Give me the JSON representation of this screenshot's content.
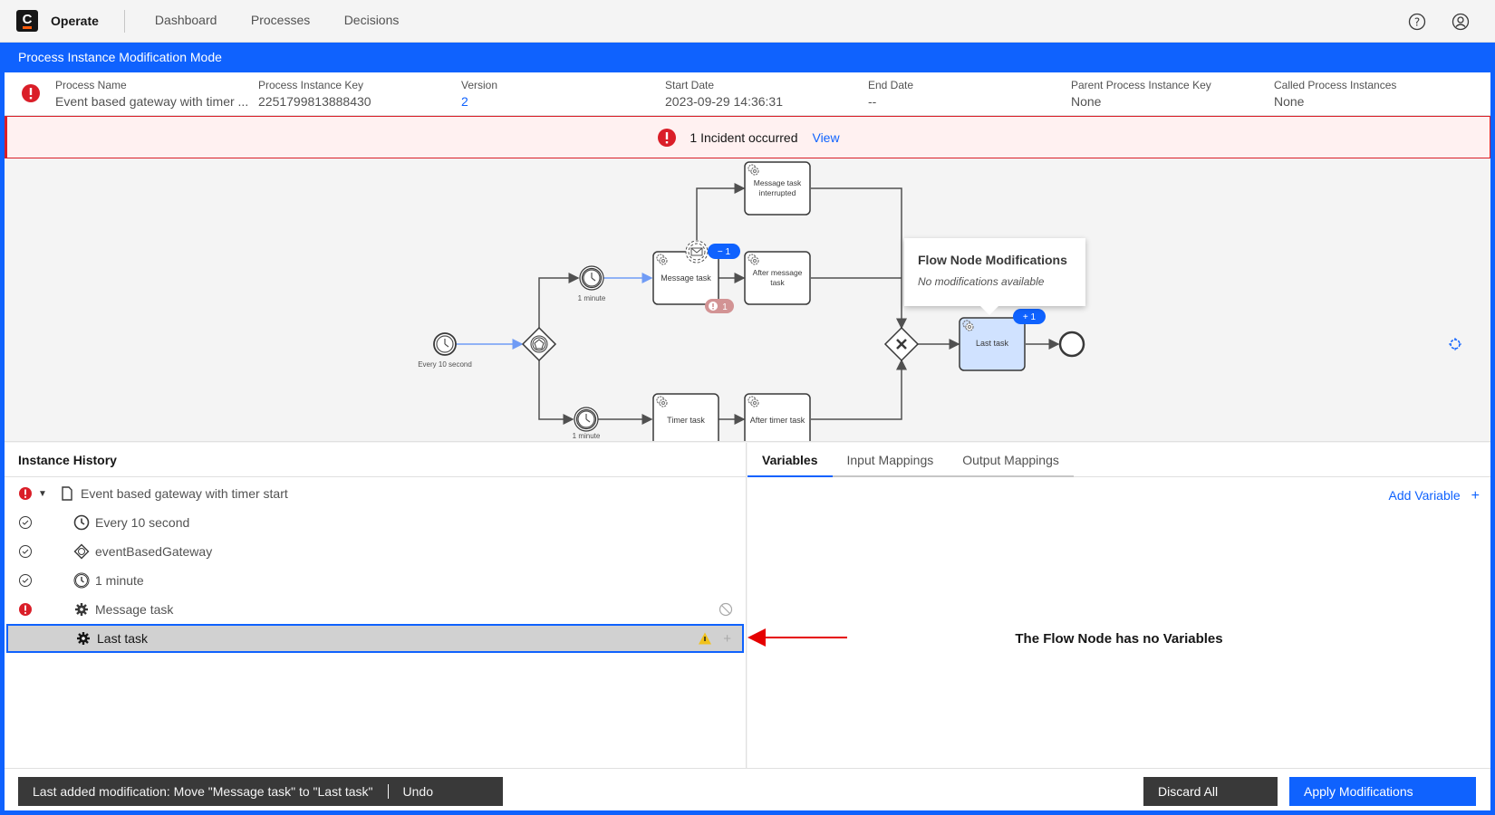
{
  "topbar": {
    "brand": "Operate",
    "logo_letter": "C",
    "nav": [
      "Dashboard",
      "Processes",
      "Decisions"
    ],
    "icons": [
      "help-icon",
      "user-profile-icon"
    ]
  },
  "mode_bar": {
    "title": "Process Instance Modification Mode"
  },
  "instance_header": {
    "state": "incident",
    "columns": [
      {
        "label": "Process Name",
        "value": "Event based gateway with timer ..."
      },
      {
        "label": "Process Instance Key",
        "value": "2251799813888430"
      },
      {
        "label": "Version",
        "value": "2"
      },
      {
        "label": "Start Date",
        "value": "2023-09-29 14:36:31"
      },
      {
        "label": "End Date",
        "value": "--"
      },
      {
        "label": "Parent Process Instance Key",
        "value": "None"
      },
      {
        "label": "Called Process Instances",
        "value": "None"
      }
    ]
  },
  "incident_banner": {
    "text": "1 Incident occurred",
    "link": "View"
  },
  "diagram": {
    "labels": {
      "start_event": "Every 10 second",
      "timer_top": "1 minute",
      "timer_bottom": "1 minute",
      "message_task": "Message task",
      "message_task_interrupted_1": "Message task",
      "message_task_interrupted_2": "interrupted",
      "after_message_task_1": "After message",
      "after_message_task_2": "task",
      "timer_task": "Timer task",
      "after_timer_task": "After timer task",
      "last_task": "Last task"
    },
    "badges": {
      "message_task_cancel": "− 1",
      "message_task_incident": "1",
      "last_task_add": "+ 1"
    },
    "tooltip": {
      "title": "Flow Node Modifications",
      "message": "No modifications available"
    },
    "zoom_controls": {
      "reset": "⌖",
      "zoom_in": "+",
      "zoom_out": "−"
    }
  },
  "instance_history": {
    "title": "Instance History",
    "rows": [
      {
        "name": "Event based gateway with timer start",
        "status": "incident",
        "icon": "document-icon",
        "expanded": true
      },
      {
        "name": "Every 10 second",
        "status": "completed",
        "icon": "timer-icon"
      },
      {
        "name": "eventBasedGateway",
        "status": "completed",
        "icon": "event-gateway-icon"
      },
      {
        "name": "1 minute",
        "status": "completed",
        "icon": "timer-intermediate-icon"
      },
      {
        "name": "Message task",
        "status": "incident",
        "icon": "service-task-icon",
        "action": "cancel-icon"
      },
      {
        "name": "Last task",
        "status": "added",
        "icon": "service-task-icon",
        "selected": true,
        "actions": [
          "warning-icon",
          "add-icon"
        ]
      }
    ]
  },
  "variables_panel": {
    "tabs": [
      "Variables",
      "Input Mappings",
      "Output Mappings"
    ],
    "active_tab": "Variables",
    "add_variable": "Add Variable",
    "add_symbol": "+",
    "empty_message": "The Flow Node has no Variables"
  },
  "footer": {
    "last_modification": "Last added modification: Move \"Message task\" to \"Last task\"",
    "undo": "Undo",
    "discard_all": "Discard All",
    "apply": "Apply Modifications"
  },
  "colors": {
    "primary": "#0f62fe",
    "incident": "#da1e28",
    "warning": "#f1c21b",
    "toast_bg": "#393939",
    "incident_bg": "#fff1f1",
    "annotation_arrow": "#e50000"
  }
}
